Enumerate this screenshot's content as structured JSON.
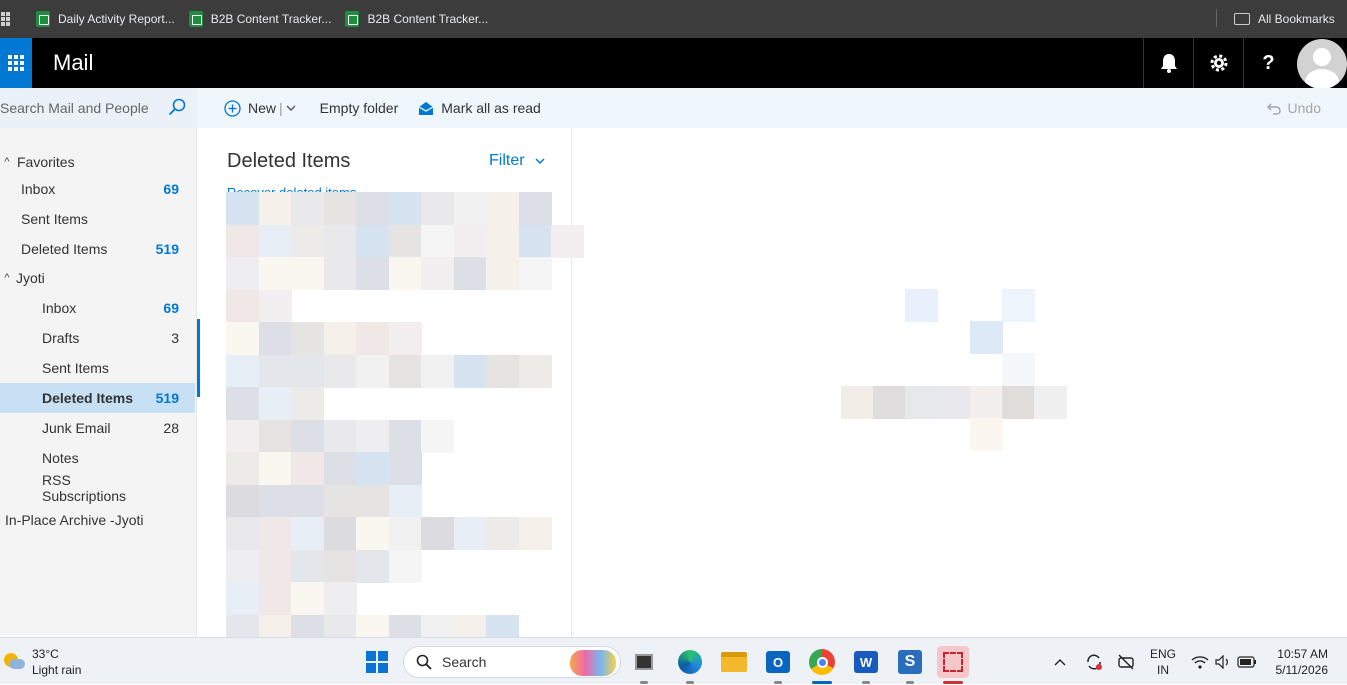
{
  "bookmarks": {
    "items": [
      {
        "label": "Daily Activity Report...",
        "icon": "sheets-icon"
      },
      {
        "label": "B2B Content Tracker...",
        "icon": "sheets-icon"
      },
      {
        "label": "B2B Content Tracker...",
        "icon": "sheets-icon"
      }
    ],
    "all_bookmarks": "All Bookmarks"
  },
  "topbar": {
    "app_title": "Mail",
    "help_label": "?"
  },
  "search": {
    "placeholder": "Search Mail and People"
  },
  "commands": {
    "new": "New",
    "empty_folder": "Empty folder",
    "mark_all_read": "Mark all as read",
    "undo": "Undo"
  },
  "folders": {
    "favorites_label": "Favorites",
    "favorites": [
      {
        "name": "Inbox",
        "count": "69"
      },
      {
        "name": "Sent Items",
        "count": ""
      },
      {
        "name": "Deleted Items",
        "count": "519"
      }
    ],
    "account_label": "Jyoti",
    "account": [
      {
        "name": "Inbox",
        "count": "69"
      },
      {
        "name": "Drafts",
        "count": "3"
      },
      {
        "name": "Sent Items",
        "count": ""
      },
      {
        "name": "Deleted Items",
        "count": "519"
      },
      {
        "name": "Junk Email",
        "count": "28"
      },
      {
        "name": "Notes",
        "count": ""
      },
      {
        "name": "RSS Subscriptions",
        "count": ""
      }
    ],
    "archive_label": "In-Place Archive -Jyoti"
  },
  "list": {
    "title": "Deleted Items",
    "filter": "Filter",
    "recover_link": "Recover deleted items"
  },
  "taskbar": {
    "temperature": "33°C",
    "weather": "Light rain",
    "search": "Search",
    "lang_top": "ENG",
    "lang_bottom": "IN",
    "time": "10:57 AM",
    "date": "5/11/2026"
  },
  "colors": {
    "accent": "#0078d4",
    "topbar": "#000000",
    "selected": "#c7e0f4"
  }
}
